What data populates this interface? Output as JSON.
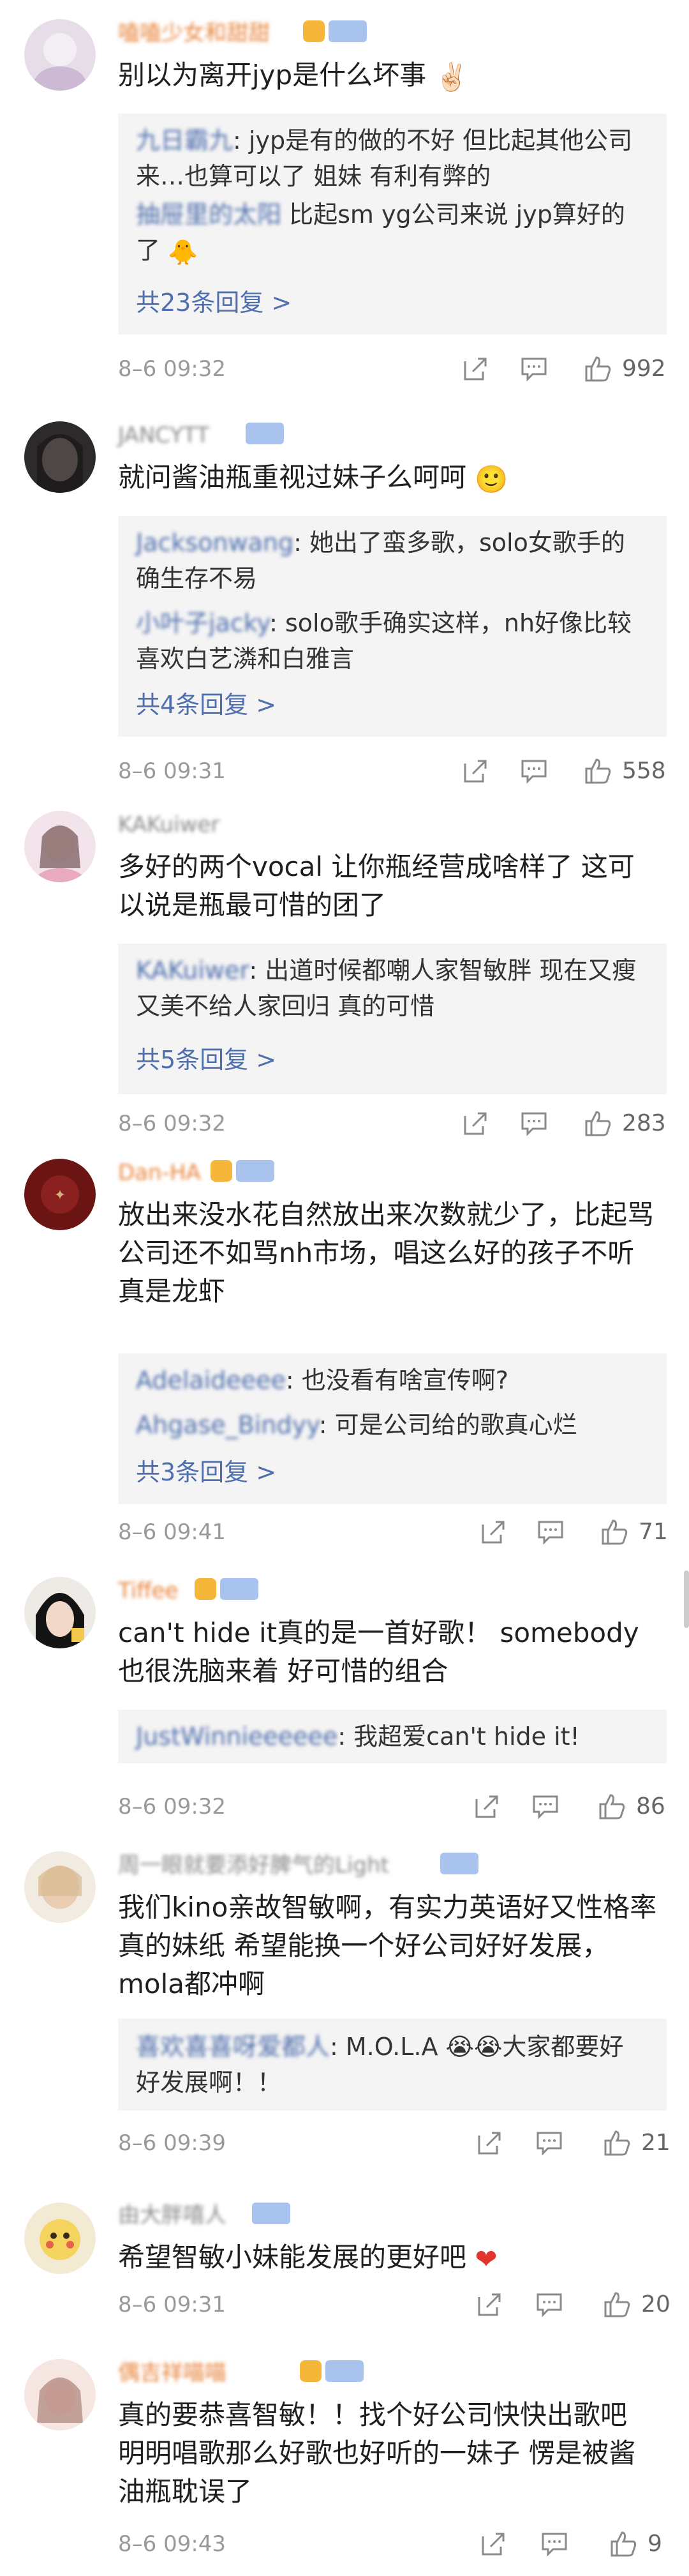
{
  "comments": [
    {
      "username": "嗑嗑少女和甜甜",
      "text": "别以为离开jyp是什么坏事",
      "replies": [
        {
          "name": "九日霸九",
          "text": ": jyp是有的做的不好 但比起其他公司来…也算可以了 姐妹 有利有弊的"
        },
        {
          "name": "抽屉里的太阳",
          "text": " 比起sm yg公司来说 jyp算好的了"
        }
      ],
      "more": "共23条回复 >",
      "time": "8–6 09:32",
      "likes": "992"
    },
    {
      "username": "JANCYTT",
      "text": "就问酱油瓶重视过妹子么呵呵",
      "replies": [
        {
          "name": "Jacksonwang",
          "text": ": 她出了蛮多歌，solo女歌手的确生存不易"
        },
        {
          "name": "小叶子jacky",
          "text": ": solo歌手确实这样，nh好像比较喜欢白艺潾和白雅言"
        }
      ],
      "more": "共4条回复 >",
      "time": "8–6 09:31",
      "likes": "558"
    },
    {
      "username": "KAKuiwer",
      "text": "多好的两个vocal 让你瓶经营成啥样了 这可以说是瓶最可惜的团了",
      "replies": [
        {
          "name": "KAKuiwer",
          "text": ": 出道时候都嘲人家智敏胖 现在又瘦又美不给人家回归 真的可惜"
        }
      ],
      "more": "共5条回复 >",
      "time": "8–6 09:32",
      "likes": "283"
    },
    {
      "username": "Dan-HA",
      "text": "放出来没水花自然放出来次数就少了，比起骂公司还不如骂nh市场，唱这么好的孩子不听真是龙虾",
      "replies": [
        {
          "name": "Adelaideeee",
          "text": ": 也没看有啥宣传啊?"
        },
        {
          "name": "Ahgase_Bindyy",
          "text": ": 可是公司给的歌真心烂"
        }
      ],
      "more": "共3条回复 >",
      "time": "8–6 09:41",
      "likes": "71"
    },
    {
      "username": "Tiffee",
      "text": "can't hide it真的是一首好歌！ somebody也很洗脑来着 好可惜的组合",
      "replies": [
        {
          "name": "JustWinnieeeeee",
          "text": ": 我超爱can't hide it!"
        }
      ],
      "more": "",
      "time": "8–6 09:32",
      "likes": "86"
    },
    {
      "username": "周一眼就要添好脾气的Light",
      "text": "我们kino亲故智敏啊，有实力英语好又性格率真的妹纸 希望能换一个好公司好好发展，mola都冲啊",
      "replies": [
        {
          "name": "喜欢喜喜呀爱都人",
          "text": ": M.O.L.A 😭😭大家都要好好发展啊！！"
        }
      ],
      "more": "",
      "time": "8–6 09:39",
      "likes": "21"
    },
    {
      "username": "由大胖嘻人",
      "text": "希望智敏小妹能发展的更好吧",
      "replies": [],
      "more": "",
      "time": "8–6 09:31",
      "likes": "20"
    },
    {
      "username": "偶吉祥喵喵",
      "text": "真的要恭喜智敏！！找个好公司快快出歌吧 明明唱歌那么好歌也好听的一妹子 愣是被酱油瓶耽误了",
      "replies": [],
      "more": "",
      "time": "8–6 09:43",
      "likes": "9"
    }
  ],
  "icons": {
    "share": "share-icon",
    "comment": "comment-icon",
    "like": "thumbs-up-icon"
  }
}
